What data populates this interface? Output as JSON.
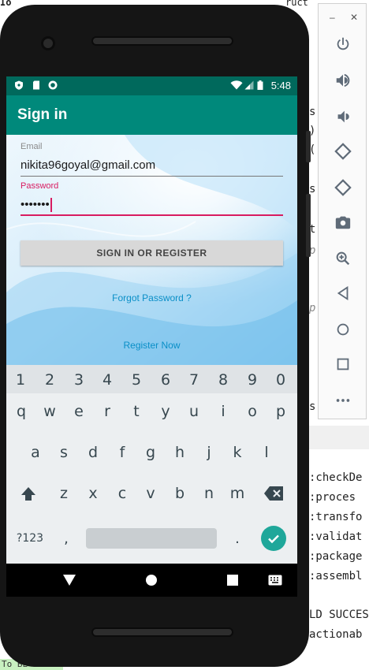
{
  "app": {
    "title": "Sign in",
    "status_time": "5:48",
    "email": {
      "label": "Email",
      "value": "nikita96goyal@gmail.com"
    },
    "password": {
      "label": "Password",
      "value": "•••••••"
    },
    "signin_button": "SIGN IN OR REGISTER",
    "forgot_link": "Forgot Password ?",
    "register_link": "Register Now"
  },
  "keyboard": {
    "number_row": [
      "1",
      "2",
      "3",
      "4",
      "5",
      "6",
      "7",
      "8",
      "9",
      "0"
    ],
    "row1": [
      "q",
      "w",
      "e",
      "r",
      "t",
      "y",
      "u",
      "i",
      "o",
      "p"
    ],
    "row2": [
      "a",
      "s",
      "d",
      "f",
      "g",
      "h",
      "j",
      "k",
      "l"
    ],
    "row3": [
      "z",
      "x",
      "c",
      "v",
      "b",
      "n",
      "m"
    ],
    "symbols_key": "?123",
    "comma_key": ",",
    "period_key": "."
  },
  "ide": {
    "top_fragment": "Io",
    "top_right_fragment": "ructu",
    "code_lines": [
      "s",
      ")",
      "(",
      "s",
      "t",
      "p",
      "p",
      "s"
    ],
    "build_lines": [
      ":checkDe",
      ":proces",
      ":transfo",
      ":validat",
      ":package",
      ":assembl",
      "",
      "LD SUCCES",
      "actionab"
    ],
    "bottom_left_fragment": "To BE RNA"
  },
  "colors": {
    "status_bar": "#00695c",
    "app_bar": "#00897b",
    "accent": "#d81b60",
    "link": "#0a8fc7",
    "enter_key": "#1fa79a"
  },
  "icons": {
    "emulator_toolbar": [
      "minimize-icon",
      "close-icon",
      "power-icon",
      "volume-up-icon",
      "volume-down-icon",
      "rotate-left-icon",
      "rotate-right-icon",
      "camera-icon",
      "zoom-icon",
      "back-triangle-icon",
      "home-circle-icon",
      "overview-square-icon",
      "more-icon"
    ]
  }
}
